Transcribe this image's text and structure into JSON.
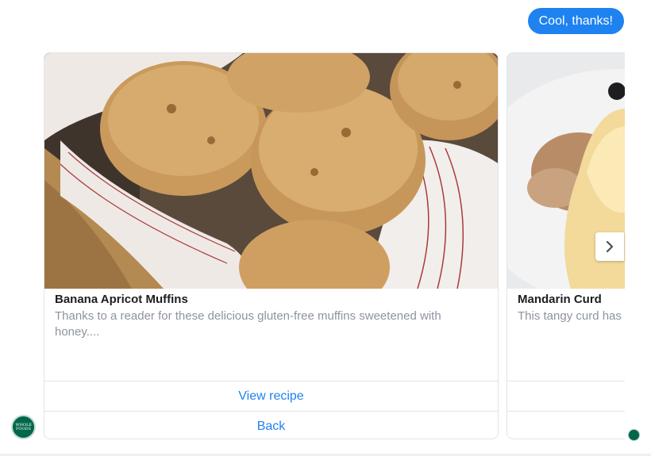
{
  "reply": {
    "text": "Cool, thanks!"
  },
  "cards": [
    {
      "title": "Banana Apricot Muffins",
      "subtitle": "Thanks to a reader for these delicious gluten-free muffins sweetened with honey....",
      "buttons": [
        "View recipe",
        "Back"
      ],
      "image": "muffins-in-basket"
    },
    {
      "title": "Mandarin Curd",
      "subtitle": "This tangy curd has mandari...",
      "image": "mandarin-curd-dessert"
    }
  ],
  "avatar": {
    "brand": "WHOLE FOODS",
    "color": "#00674b"
  },
  "colors": {
    "accent": "#1f82f1",
    "subtitle": "#8d949e",
    "title": "#1c1e21"
  }
}
